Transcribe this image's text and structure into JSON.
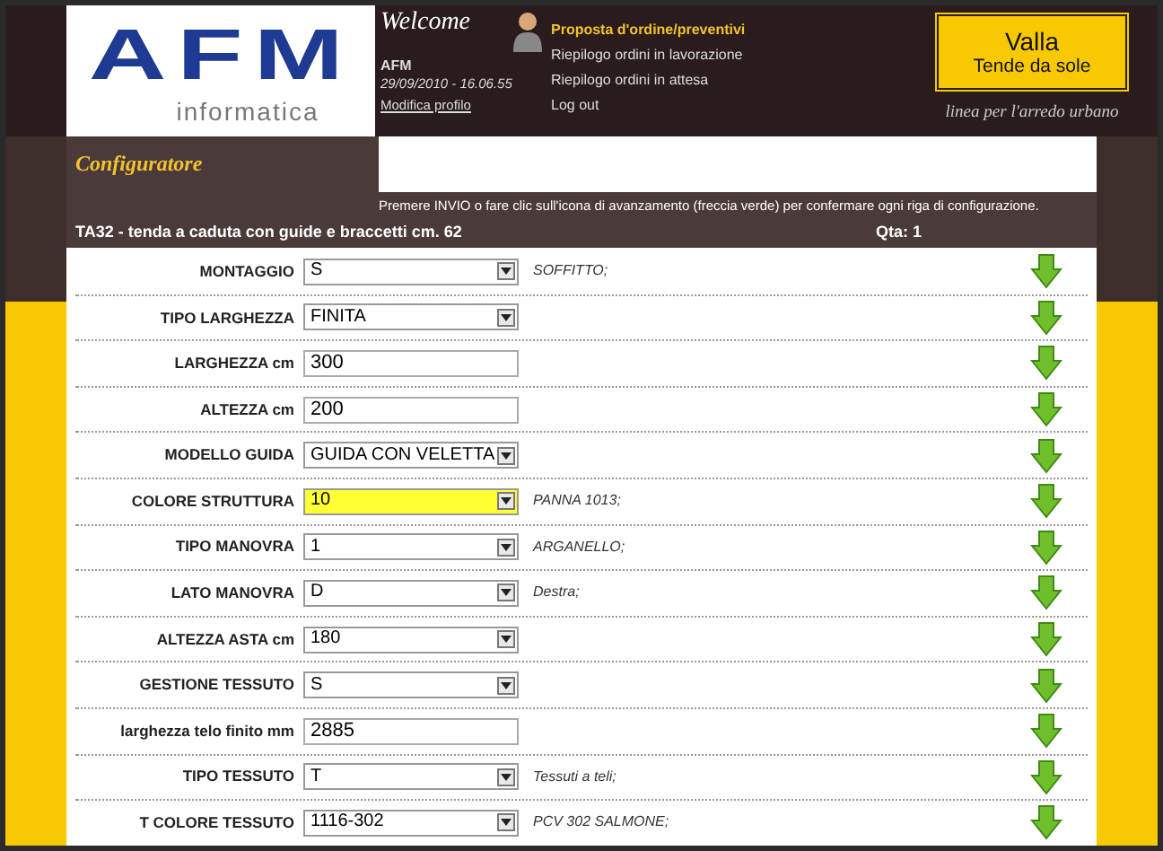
{
  "logo": {
    "main": "AFM",
    "sub": "informatica"
  },
  "welcome": {
    "title": "Welcome",
    "user": "AFM",
    "datetime": "29/09/2010 - 16.06.55",
    "profile_link": "Modifica profilo"
  },
  "nav": [
    {
      "label": "Proposta d'ordine/preventivi",
      "selected": true
    },
    {
      "label": "Riepilogo ordini in lavorazione",
      "selected": false
    },
    {
      "label": "Riepilogo ordini in attesa",
      "selected": false
    },
    {
      "label": "Log out",
      "selected": false
    }
  ],
  "brand": {
    "name": "Valla",
    "subtitle": "Tende da sole",
    "tagline": "linea per l'arredo urbano"
  },
  "page_title": "Configuratore",
  "instructions": "Premere INVIO o fare clic sull'icona di avanzamento (freccia verde) per confermare ogni riga di configurazione.",
  "product": {
    "title": "TA32 - tenda a caduta con guide e braccetti cm. 62",
    "quantity": "Qta: 1"
  },
  "rows": [
    {
      "label": "MONTAGGIO",
      "kind": "select",
      "value": "S",
      "description": "SOFFITTO;",
      "highlighted": false
    },
    {
      "label": "TIPO LARGHEZZA",
      "kind": "select",
      "value": "FINITA",
      "highlighted": false
    },
    {
      "label": "LARGHEZZA cm",
      "kind": "text",
      "value": "300",
      "highlighted": false
    },
    {
      "label": "ALTEZZA cm",
      "kind": "text",
      "value": "200",
      "highlighted": false
    },
    {
      "label": "MODELLO GUIDA",
      "kind": "select",
      "value": "GUIDA CON VELETTA",
      "highlighted": false
    },
    {
      "label": "COLORE STRUTTURA",
      "kind": "select",
      "value": "10",
      "description": "PANNA 1013;",
      "highlighted": true
    },
    {
      "label": "TIPO MANOVRA",
      "kind": "select",
      "value": "1",
      "description": "ARGANELLO;",
      "highlighted": false
    },
    {
      "label": "LATO MANOVRA",
      "kind": "select",
      "value": "D",
      "description": "Destra;",
      "highlighted": false
    },
    {
      "label": "ALTEZZA ASTA cm",
      "kind": "select",
      "value": "180",
      "highlighted": false
    },
    {
      "label": "GESTIONE TESSUTO",
      "kind": "select",
      "value": "S",
      "highlighted": false
    },
    {
      "label": "larghezza telo finito mm",
      "kind": "text",
      "value": "2885",
      "highlighted": false
    },
    {
      "label": "TIPO TESSUTO",
      "kind": "select",
      "value": "T",
      "description": "Tessuti a teli;",
      "highlighted": false
    },
    {
      "label": "T COLORE TESSUTO",
      "kind": "select",
      "value": "1116-302",
      "description": "PCV 302 SALMONE;",
      "highlighted": false
    }
  ]
}
